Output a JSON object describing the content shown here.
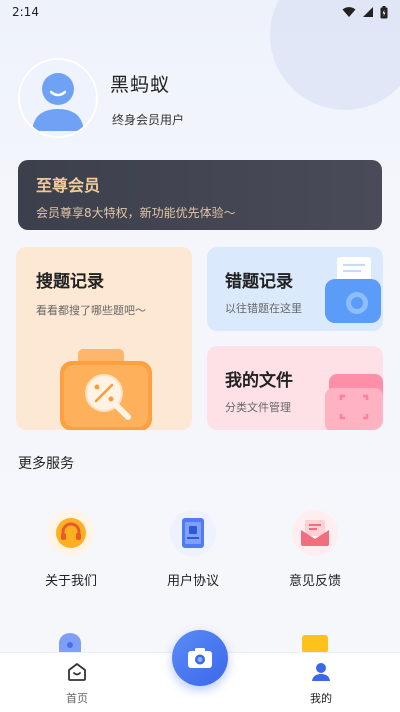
{
  "status_bar": {
    "time": "2:14"
  },
  "profile": {
    "username": "黑蚂蚁",
    "member_type": "终身会员用户"
  },
  "vip": {
    "title": "至尊会员",
    "subtitle": "会员尊享8大特权，新功能优先体验～"
  },
  "cards": {
    "search_history": {
      "title": "搜题记录",
      "desc": "看看都搜了哪些题吧～"
    },
    "error_records": {
      "title": "错题记录",
      "desc": "以往错题在这里"
    },
    "my_files": {
      "title": "我的文件",
      "desc": "分类文件管理"
    }
  },
  "services": {
    "title": "更多服务",
    "items": [
      {
        "label": "关于我们",
        "icon": "headset-icon"
      },
      {
        "label": "用户协议",
        "icon": "document-icon"
      },
      {
        "label": "意见反馈",
        "icon": "mail-icon"
      }
    ]
  },
  "bottom_nav": {
    "home_label": "首页",
    "mine_label": "我的"
  },
  "colors": {
    "accent": "#3b67ea",
    "vip_gold": "#f2c99a",
    "card_orange": "#fde8d4",
    "card_blue": "#dbe9fd",
    "card_pink": "#fde1e6"
  }
}
